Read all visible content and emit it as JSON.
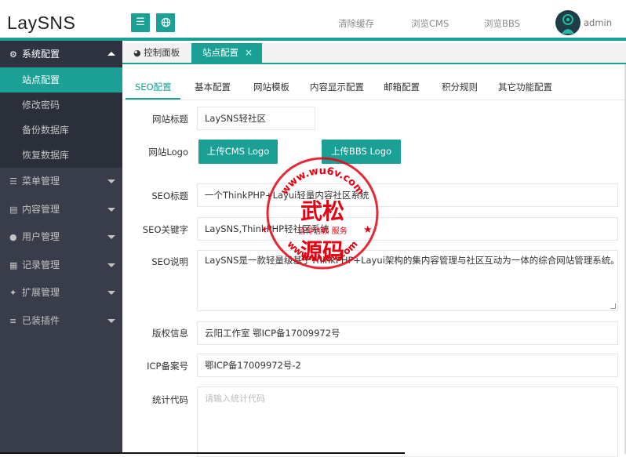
{
  "app": {
    "logo": "LaySNS"
  },
  "header": {
    "menu_icon": "hamburger-icon",
    "globe_icon": "globe-icon",
    "links": [
      "清除缓存",
      "浏览CMS",
      "浏览BBS"
    ],
    "user": "admin"
  },
  "sidebar": {
    "group_open": {
      "label": "系统配置",
      "icon": "gears-icon"
    },
    "subitems": [
      "站点配置",
      "修改密码",
      "备份数据库",
      "恢复数据库"
    ],
    "active_subitem": "站点配置",
    "groups": [
      {
        "label": "菜单管理",
        "icon": "list-icon"
      },
      {
        "label": "内容管理",
        "icon": "file-icon"
      },
      {
        "label": "用户管理",
        "icon": "users-icon"
      },
      {
        "label": "记录管理",
        "icon": "grid-icon"
      },
      {
        "label": "扩展管理",
        "icon": "wrench-icon"
      },
      {
        "label": "已装插件",
        "icon": "sliders-icon"
      }
    ]
  },
  "page_tabs": {
    "dashboard": "控制面板",
    "current": "站点配置",
    "close_glyph": "×"
  },
  "sub_tabs": [
    "SEO配置",
    "基本配置",
    "网站模板",
    "内容显示配置",
    "邮箱配置",
    "积分规则",
    "其它功能配置"
  ],
  "active_sub_tab": "SEO配置",
  "form": {
    "site_title": {
      "label": "网站标题",
      "value": "LaySNS轻社区"
    },
    "site_logo": {
      "label": "网站Logo",
      "btn_cms": "上传CMS Logo",
      "btn_bbs": "上传BBS Logo"
    },
    "seo_title": {
      "label": "SEO标题",
      "value": "一个ThinkPHP+Layui轻量内容社区系统"
    },
    "seo_keywords": {
      "label": "SEO关键字",
      "value": "LaySNS,ThinkPHP轻社区系统"
    },
    "seo_desc": {
      "label": "SEO说明",
      "value": "LaySNS是一款轻量级基于ThinkPHP+Layui架构的集内容管理与社区互动为一体的综合网站管理系统。"
    },
    "copyright": {
      "label": "版权信息",
      "value": "云阳工作室 鄂ICP备17009972号"
    },
    "icp": {
      "label": "ICP备案号",
      "value": "鄂ICP备17009972号-2"
    },
    "stats": {
      "label": "统计代码",
      "placeholder": "请输入统计代码"
    }
  },
  "watermark": {
    "top": "www.wu6v.com",
    "bottom": "www.wu6v.com",
    "big1": "武松",
    "big2": "源码",
    "middle": "值得信赖 服务",
    "color": "#e60012"
  },
  "colors": {
    "accent": "#1aa094",
    "sidebar": "#393d49"
  }
}
